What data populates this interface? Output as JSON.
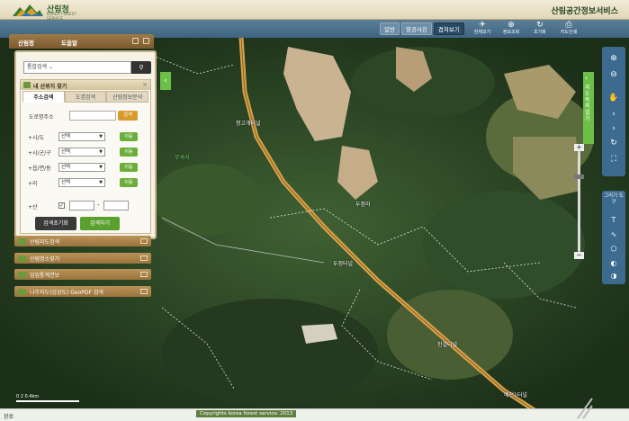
{
  "header": {
    "logo_name": "산림청",
    "logo_sub": "KOREA FOREST SERVICE",
    "service_title": "산림공간정보서비스"
  },
  "toolbar": {
    "map_types": [
      {
        "label": "일반",
        "active": false
      },
      {
        "label": "항공사진",
        "active": false
      },
      {
        "label": "겹쳐보기",
        "active": true
      }
    ],
    "tools": [
      {
        "label": "전체보기",
        "icon": "globe-icon"
      },
      {
        "label": "정보조회",
        "icon": "info-icon"
      },
      {
        "label": "초기화",
        "icon": "refresh-icon"
      },
      {
        "label": "지도인쇄",
        "icon": "print-icon"
      }
    ]
  },
  "panel": {
    "top_left": "산림청",
    "top_right": "도움말",
    "search_select": "통합검색",
    "loc_title": "내 산위치 찾기",
    "tabs": [
      {
        "label": "주소검색",
        "active": true
      },
      {
        "label": "도엽검색",
        "active": false
      },
      {
        "label": "산림정보분석",
        "active": false
      }
    ],
    "road_label": "도로명주소",
    "road_button": "검색",
    "address_rows": [
      {
        "label": "시/도",
        "select": "선택",
        "move": "이동"
      },
      {
        "label": "시/군/구",
        "select": "선택",
        "move": "이동"
      },
      {
        "label": "읍/면/동",
        "select": "선택",
        "move": "이동"
      },
      {
        "label": "리",
        "select": "선택",
        "move": "이동"
      }
    ],
    "san_label": "산",
    "san_check": "✓",
    "san_dash": "-",
    "reset_button": "검색초기화",
    "search_button": "검색하기",
    "accordions": [
      "산림지도검색",
      "산림명소찾기",
      "임업통계연보",
      "나무지도(임상도) GeoPDF 검색"
    ]
  },
  "map": {
    "labels": [
      {
        "text": "무곡리"
      },
      {
        "text": "청고개터널"
      },
      {
        "text": "두정리"
      },
      {
        "text": "두정터널"
      },
      {
        "text": "한결터널"
      },
      {
        "text": "예천1터널"
      }
    ]
  },
  "right_panel": {
    "layer_tab": "지도목록 열기",
    "draw_title": "그리기 도구"
  },
  "footer": {
    "status": "완료",
    "copyright": "Copyrights korea forest service. 2013",
    "scale": "0    2    0.4km"
  },
  "colors": {
    "header_bg": "#e9dfc4",
    "toolbar_bg": "#4b7190",
    "accent_green": "#6cc04a",
    "panel_brown": "#9f7a48"
  }
}
